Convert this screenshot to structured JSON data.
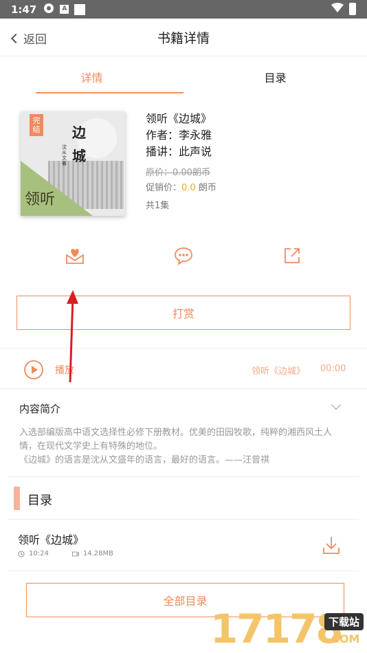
{
  "status_bar": {
    "time": "1:47",
    "notif_letter": "A"
  },
  "header": {
    "back_label": "返回",
    "title": "书籍详情"
  },
  "tabs": [
    {
      "label": "详情",
      "active": true
    },
    {
      "label": "目录",
      "active": false
    }
  ],
  "book": {
    "cover_badge": "完结",
    "cover_title": "边城",
    "cover_author": "沈从文著",
    "cover_corner": "领听",
    "name": "领听《边城》",
    "author": "作者：李永雅",
    "narrator": "播讲：此声说",
    "price_original": "原价：0.00朗币",
    "price_sale_label": "促销价：",
    "price_sale_value": "0.0",
    "price_sale_unit": " 朗币",
    "episodes": "共1集"
  },
  "actions": {
    "reward_label": "打赏"
  },
  "player": {
    "label": "播放",
    "track": "领听《边城》",
    "time": "00:00"
  },
  "intro": {
    "title": "内容简介",
    "text_1": "入选部编版高中语文选择性必修下册教材。优美的田园牧歌，纯粹的湘西风土人情，在现代文学史上有特殊的地位。",
    "text_2": "《边城》的语言是沈从文盛年的语言，最好的语言。——汪曾祺"
  },
  "toc": {
    "title": "目录",
    "chapters": [
      {
        "name": "领听《边城》",
        "duration": "10:24",
        "size": "14.28MB"
      }
    ],
    "all_label": "全部目录"
  },
  "watermark": {
    "number": "17178",
    "tag": "下载站",
    "suffix": ".COM"
  },
  "colors": {
    "accent": "#f08a5d",
    "price": "#f5a623",
    "arrow": "#d42020"
  }
}
